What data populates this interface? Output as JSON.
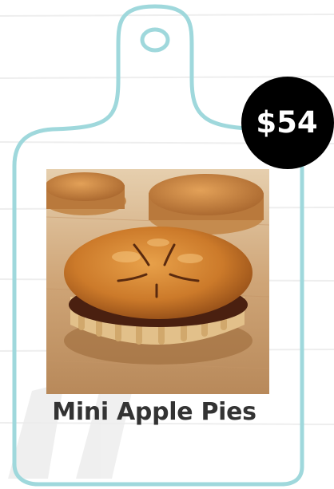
{
  "product": {
    "name": "Mini Apple Pies",
    "price": "$54",
    "image_icon": "apple-pie-photo"
  },
  "colors": {
    "board_outline": "#9fd8dc",
    "badge_background": "#000000",
    "badge_text": "#ffffff",
    "name_text": "#333333",
    "background": "#ffffff"
  }
}
